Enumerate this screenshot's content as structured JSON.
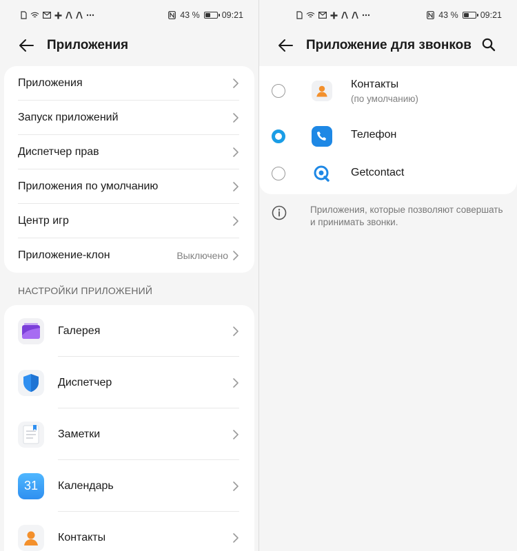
{
  "status": {
    "percent": "43 %",
    "time": "09:21",
    "battery_level": 0.43
  },
  "left": {
    "title": "Приложения",
    "menu": [
      {
        "label": "Приложения"
      },
      {
        "label": "Запуск приложений"
      },
      {
        "label": "Диспетчер прав"
      },
      {
        "label": "Приложения по умолчанию"
      },
      {
        "label": "Центр игр"
      },
      {
        "label": "Приложение-клон",
        "value": "Выключено"
      }
    ],
    "section_title": "НАСТРОЙКИ ПРИЛОЖЕНИЙ",
    "apps": [
      {
        "label": "Галерея",
        "icon": "gallery-icon"
      },
      {
        "label": "Диспетчер",
        "icon": "shield-icon"
      },
      {
        "label": "Заметки",
        "icon": "notes-icon"
      },
      {
        "label": "Календарь",
        "icon": "calendar-icon",
        "icon_text": "31"
      },
      {
        "label": "Контакты",
        "icon": "contacts-icon"
      }
    ]
  },
  "right": {
    "title": "Приложение для звонков",
    "options": [
      {
        "name": "Контакты",
        "sub": "(по умолчанию)",
        "selected": false,
        "icon": "contacts-icon"
      },
      {
        "name": "Телефон",
        "selected": true,
        "icon": "phone-icon"
      },
      {
        "name": "Getcontact",
        "selected": false,
        "icon": "getcontact-icon"
      }
    ],
    "info_text": "Приложения, которые позволяют совершать и принимать звонки."
  },
  "colors": {
    "accent": "#1a9de6",
    "background": "#f5f5f5",
    "card": "#ffffff"
  }
}
